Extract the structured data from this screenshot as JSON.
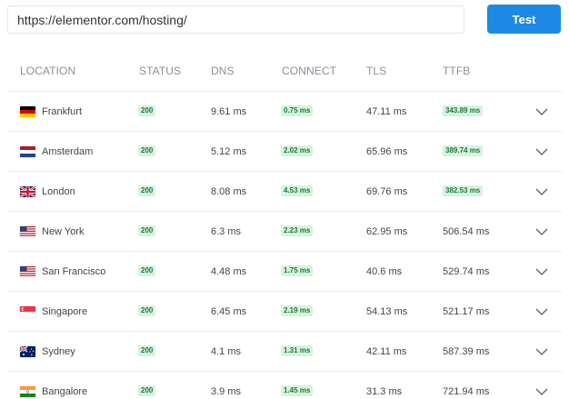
{
  "url_input": {
    "value": "https://elementor.com/hosting/"
  },
  "test_button": {
    "label": "Test"
  },
  "columns": [
    "LOCATION",
    "STATUS",
    "DNS",
    "CONNECT",
    "TLS",
    "TTFB"
  ],
  "badge_color": "#d8f2de",
  "badge_text_color": "#1f7a3a",
  "button_color": "#1e88e5",
  "rows": [
    {
      "flag": "germany-flag",
      "location": "Frankfurt",
      "status": "200",
      "dns": "9.61 ms",
      "connect": "0.75 ms",
      "tls": "47.11 ms",
      "ttfb": "343.89 ms",
      "ttfb_badge": true
    },
    {
      "flag": "netherlands-flag",
      "location": "Amsterdam",
      "status": "200",
      "dns": "5.12 ms",
      "connect": "2.02 ms",
      "tls": "65.96 ms",
      "ttfb": "389.74 ms",
      "ttfb_badge": true
    },
    {
      "flag": "uk-flag",
      "location": "London",
      "status": "200",
      "dns": "8.08 ms",
      "connect": "4.53 ms",
      "tls": "69.76 ms",
      "ttfb": "382.53 ms",
      "ttfb_badge": true
    },
    {
      "flag": "usa-flag",
      "location": "New York",
      "status": "200",
      "dns": "6.3 ms",
      "connect": "2.23 ms",
      "tls": "62.95 ms",
      "ttfb": "506.54 ms",
      "ttfb_badge": false
    },
    {
      "flag": "usa-flag",
      "location": "San Francisco",
      "status": "200",
      "dns": "4.48 ms",
      "connect": "1.75 ms",
      "tls": "40.6 ms",
      "ttfb": "529.74 ms",
      "ttfb_badge": false
    },
    {
      "flag": "singapore-flag",
      "location": "Singapore",
      "status": "200",
      "dns": "6.45 ms",
      "connect": "2.19 ms",
      "tls": "54.13 ms",
      "ttfb": "521.17 ms",
      "ttfb_badge": false
    },
    {
      "flag": "australia-flag",
      "location": "Sydney",
      "status": "200",
      "dns": "4.1 ms",
      "connect": "1.31 ms",
      "tls": "42.11 ms",
      "ttfb": "587.39 ms",
      "ttfb_badge": false
    },
    {
      "flag": "india-flag",
      "location": "Bangalore",
      "status": "200",
      "dns": "3.9 ms",
      "connect": "1.45 ms",
      "tls": "31.3 ms",
      "ttfb": "721.94 ms",
      "ttfb_badge": false
    }
  ]
}
